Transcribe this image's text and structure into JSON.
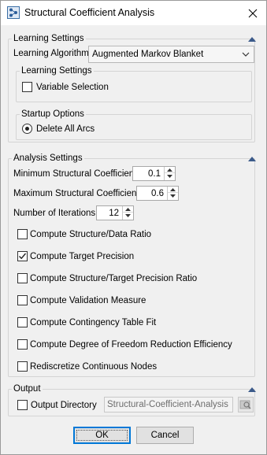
{
  "window": {
    "title": "Structural Coefficient Analysis"
  },
  "learning_settings": {
    "group_label": "Learning Settings",
    "algorithm_label": "Learning Algorithm",
    "algorithm_value": "Augmented Markov Blanket",
    "sub_group_label": "Learning Settings",
    "variable_selection_label": "Variable Selection",
    "variable_selection_checked": false,
    "startup_group_label": "Startup Options",
    "delete_all_arcs_label": "Delete All Arcs",
    "delete_all_arcs_selected": true
  },
  "analysis_settings": {
    "group_label": "Analysis Settings",
    "min_coef_label": "Minimum Structural Coefficient",
    "min_coef_value": "0.1",
    "max_coef_label": "Maximum Structural Coefficient",
    "max_coef_value": "0.6",
    "iterations_label": "Number of Iterations",
    "iterations_value": "12",
    "checkboxes": [
      {
        "label": "Compute Structure/Data Ratio",
        "checked": false
      },
      {
        "label": "Compute Target Precision",
        "checked": true
      },
      {
        "label": "Compute Structure/Target Precision Ratio",
        "checked": false
      },
      {
        "label": "Compute Validation Measure",
        "checked": false
      },
      {
        "label": "Compute Contingency Table Fit",
        "checked": false
      },
      {
        "label": "Compute Degree of Freedom Reduction Efficiency",
        "checked": false
      },
      {
        "label": "Rediscretize Continuous Nodes",
        "checked": false
      }
    ]
  },
  "output": {
    "group_label": "Output",
    "output_directory_label": "Output Directory",
    "output_directory_checked": false,
    "output_directory_value": "Structural-Coefficient-Analysis"
  },
  "buttons": {
    "ok_label": "OK",
    "cancel_label": "Cancel"
  },
  "icons": {
    "app": "network-app-icon",
    "close": "close-icon",
    "collapse": "collapse-arrow-icon",
    "dropdown": "chevron-down-icon",
    "browse": "folder-search-icon"
  },
  "colors": {
    "accent": "#0078d7",
    "collapse_arrow": "#3b5a8a"
  }
}
